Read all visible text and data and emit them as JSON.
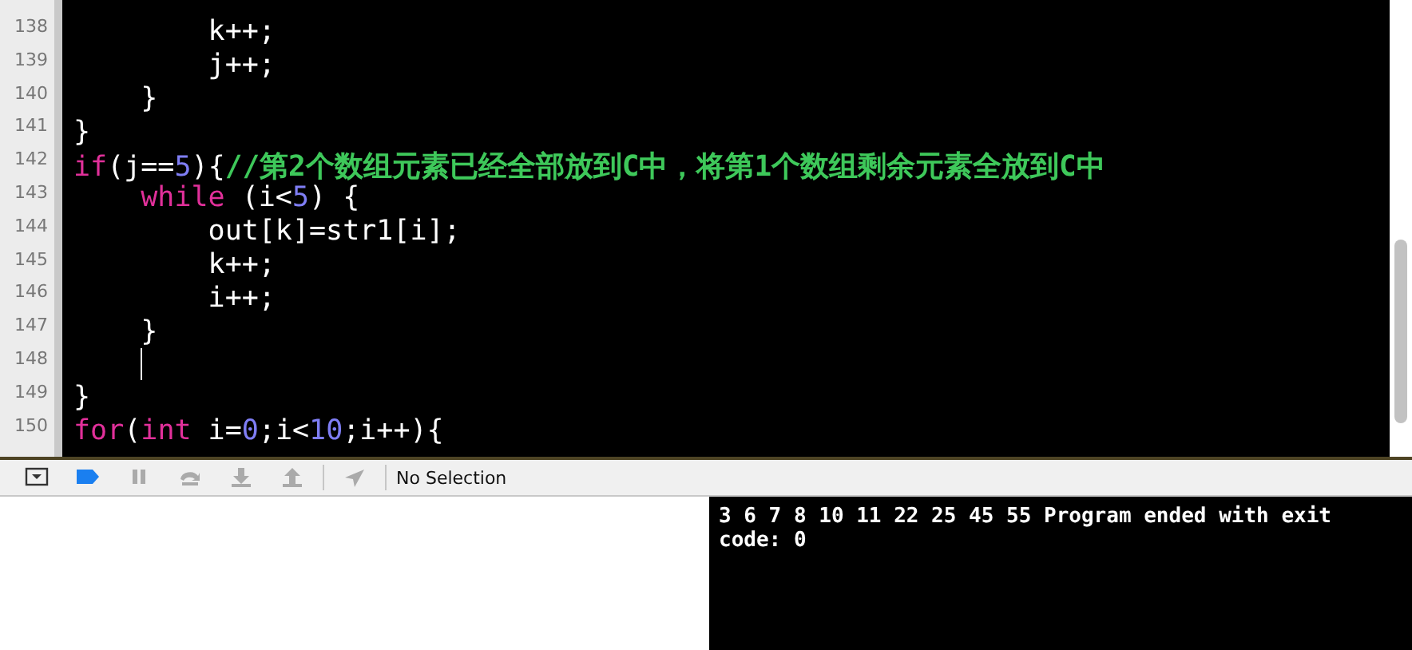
{
  "editor": {
    "lines": [
      {
        "number": "138",
        "has_cursor": false,
        "tokens": [
          {
            "kind": "plain",
            "text": "        k++;"
          }
        ]
      },
      {
        "number": "139",
        "has_cursor": false,
        "tokens": [
          {
            "kind": "plain",
            "text": "        j++;"
          }
        ]
      },
      {
        "number": "140",
        "has_cursor": false,
        "tokens": [
          {
            "kind": "plain",
            "text": "    }"
          }
        ]
      },
      {
        "number": "141",
        "has_cursor": false,
        "tokens": [
          {
            "kind": "plain",
            "text": "}"
          }
        ]
      },
      {
        "number": "142",
        "has_cursor": false,
        "tokens": [
          {
            "kind": "keyword",
            "text": "if"
          },
          {
            "kind": "plain",
            "text": "(j=="
          },
          {
            "kind": "number",
            "text": "5"
          },
          {
            "kind": "plain",
            "text": "){"
          },
          {
            "kind": "comment",
            "text": "//第2个数组元素已经全部放到C中，将第1个数组剩余元素全放到C中"
          }
        ]
      },
      {
        "number": "143",
        "has_cursor": false,
        "tokens": [
          {
            "kind": "keyword",
            "text": "    while"
          },
          {
            "kind": "plain",
            "text": " (i<"
          },
          {
            "kind": "number",
            "text": "5"
          },
          {
            "kind": "plain",
            "text": ") {"
          }
        ]
      },
      {
        "number": "144",
        "has_cursor": false,
        "tokens": [
          {
            "kind": "plain",
            "text": "        out[k]=str1[i];"
          }
        ]
      },
      {
        "number": "145",
        "has_cursor": false,
        "tokens": [
          {
            "kind": "plain",
            "text": "        k++;"
          }
        ]
      },
      {
        "number": "146",
        "has_cursor": false,
        "tokens": [
          {
            "kind": "plain",
            "text": "        i++;"
          }
        ]
      },
      {
        "number": "147",
        "has_cursor": false,
        "tokens": [
          {
            "kind": "plain",
            "text": "    }"
          }
        ]
      },
      {
        "number": "148",
        "has_cursor": true
      },
      {
        "number": "149",
        "has_cursor": false,
        "tokens": [
          {
            "kind": "plain",
            "text": "}"
          }
        ]
      },
      {
        "number": "150",
        "has_cursor": false,
        "tokens": [
          {
            "kind": "keyword",
            "text": "for"
          },
          {
            "kind": "plain",
            "text": "("
          },
          {
            "kind": "keyword",
            "text": "int"
          },
          {
            "kind": "plain",
            "text": " i="
          },
          {
            "kind": "number",
            "text": "0"
          },
          {
            "kind": "plain",
            "text": ";i<"
          },
          {
            "kind": "number",
            "text": "10"
          },
          {
            "kind": "plain",
            "text": ";i++){"
          }
        ]
      }
    ]
  },
  "debug_bar": {
    "controls": [
      {
        "kind": "console-toggle"
      },
      {
        "kind": "breakpoints"
      },
      {
        "kind": "pause"
      },
      {
        "kind": "step-over"
      },
      {
        "kind": "step-into"
      },
      {
        "kind": "step-out"
      },
      {
        "kind": "location"
      }
    ],
    "breakpoints_active": true,
    "selection_label": "No Selection"
  },
  "console": {
    "output": "3 6 7 8 10 11 22 25 45 55 Program ended with exit code: 0"
  }
}
